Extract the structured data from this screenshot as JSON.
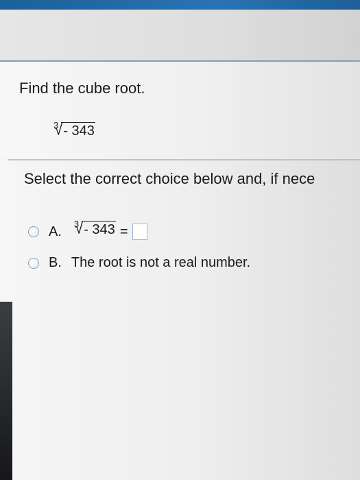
{
  "question": {
    "prompt": "Find the cube root.",
    "expression": {
      "index": "3",
      "radicand": "- 343"
    }
  },
  "instruction": "Select the correct choice below and, if nece",
  "options": [
    {
      "letter": "A.",
      "expression": {
        "index": "3",
        "radicand": "- 343"
      },
      "equals": "=",
      "answer_value": ""
    },
    {
      "letter": "B.",
      "text": "The root is not a real number."
    }
  ],
  "colors": {
    "top_bar": "#2a73b3",
    "divider": "#7e9fc5",
    "radio_border": "#8a9fb7",
    "answer_box_border": "#9fb6d4"
  }
}
